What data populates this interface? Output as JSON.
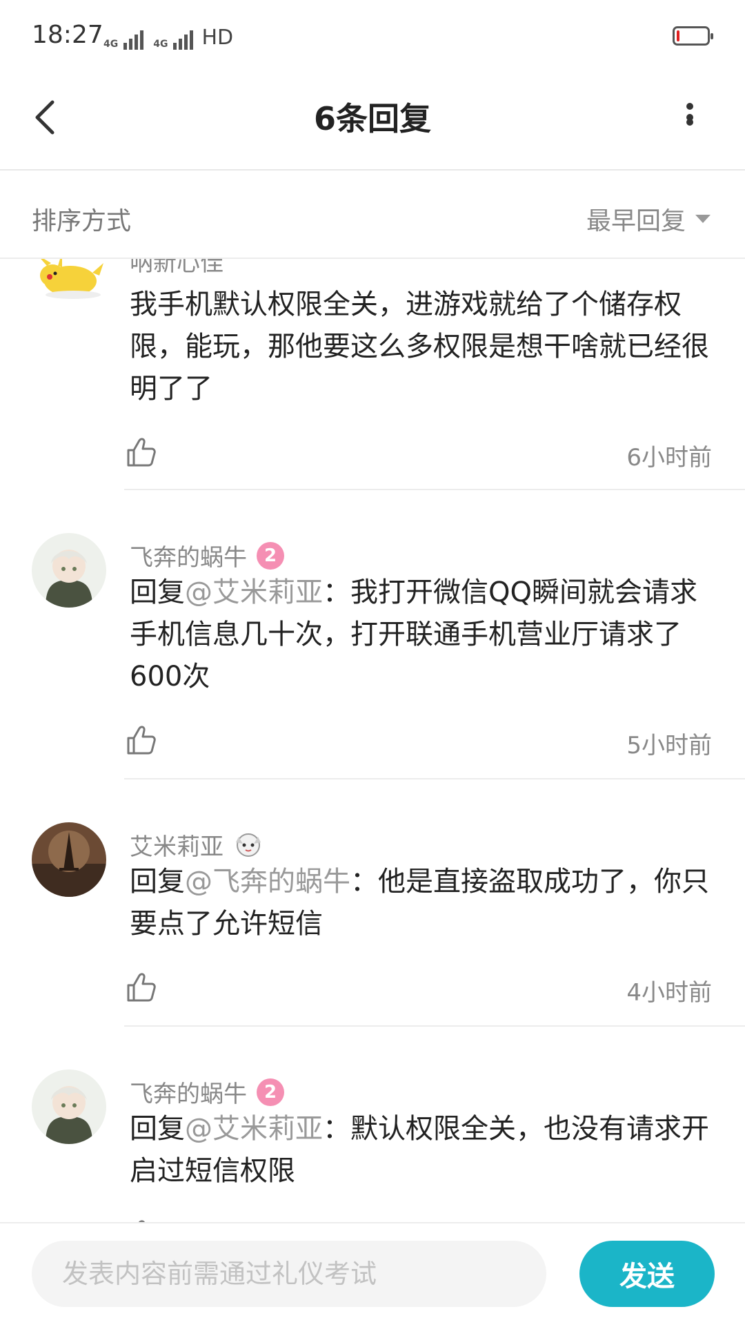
{
  "status_bar": {
    "time": "18:27",
    "network_1": "4G",
    "network_2": "4G",
    "hd_label": "HD"
  },
  "header": {
    "title": "6条回复",
    "back_icon": "chevron-left-icon",
    "more_icon": "more-vertical-icon"
  },
  "sort": {
    "label": "排序方式",
    "selected": "最早回复"
  },
  "comments": [
    {
      "name": "呐新心佳",
      "text_prefix": "",
      "mention": "",
      "text_body": "我手机默认权限全关，进游戏就给了个储存权限，能玩，那他要这么多权限是想干啥就已经很明了了",
      "time": "6小时前",
      "avatar": "pikachu-avatar"
    },
    {
      "name": "飞奔的蜗牛",
      "badge": "2",
      "text_prefix": "回复",
      "mention": "@艾米莉亚",
      "text_body": "：我打开微信QQ瞬间就会请求手机信息几十次，打开联通手机营业厅请求了600次",
      "time": "5小时前",
      "avatar": "anime-boy-avatar"
    },
    {
      "name": "艾米莉亚",
      "badge": "mascot-icon",
      "text_prefix": "回复",
      "mention": "@飞奔的蜗牛",
      "text_body": "：他是直接盗取成功了，你只要点了允许短信",
      "time": "4小时前",
      "avatar": "eiffel-tower-avatar"
    },
    {
      "name": "飞奔的蜗牛",
      "badge": "2",
      "text_prefix": "回复",
      "mention": "@艾米莉亚",
      "text_body": "：默认权限全关，也没有请求开启过短信权限",
      "time": "",
      "avatar": "anime-boy-avatar"
    }
  ],
  "composer": {
    "placeholder": "发表内容前需通过礼仪考试",
    "send_label": "发送"
  },
  "colors": {
    "accent": "#1bb5c8",
    "badge_pink": "#f58fb3",
    "muted_text": "#888888"
  }
}
